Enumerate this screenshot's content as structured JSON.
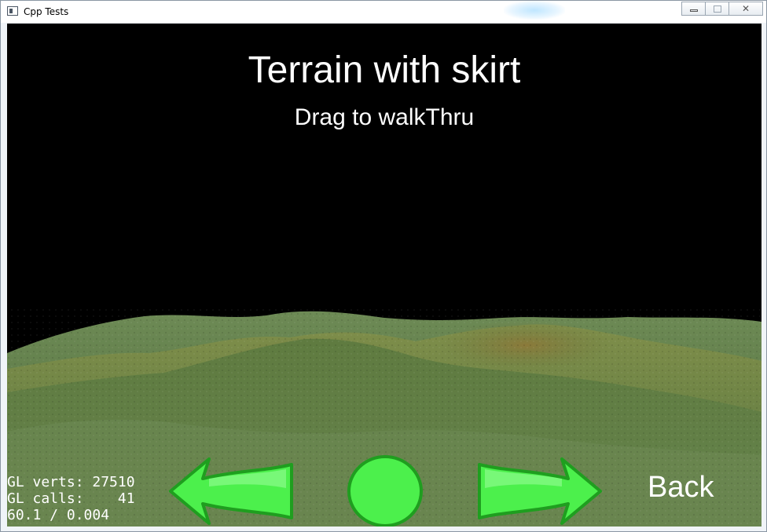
{
  "window": {
    "title": "Cpp Tests",
    "controls": {
      "minimize": "minimize",
      "maximize": "maximize",
      "close": "close"
    }
  },
  "scene": {
    "title": "Terrain with skirt",
    "subtitle": "Drag to walkThru"
  },
  "stats": {
    "verts_line": "GL verts: 27510",
    "calls_line": "GL calls:    41",
    "fps_line": "60.1 / 0.004"
  },
  "controls": {
    "prev_icon": "green-left-arrow",
    "restart_icon": "green-circle",
    "next_icon": "green-right-arrow",
    "back_label": "Back"
  },
  "colors": {
    "button_green": "#4cf04c",
    "button_dark_green": "#1f9e1f",
    "sky": "#000000",
    "grass": "#5d7a3e"
  }
}
